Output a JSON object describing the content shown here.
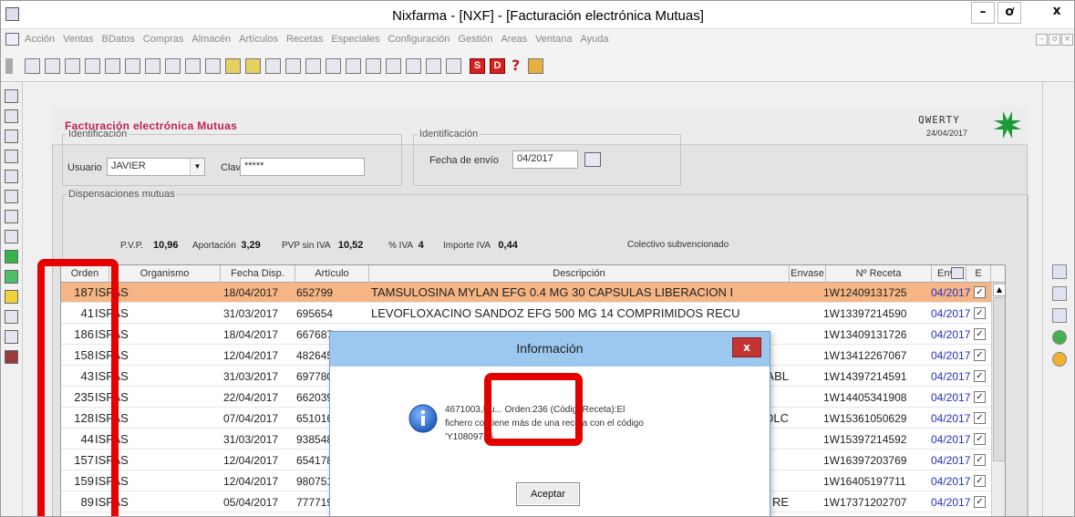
{
  "window": {
    "title": "Nixfarma - [NXF] - [Facturación electrónica Mutuas]",
    "controls": {
      "minimize": "–",
      "maximize": "ơ",
      "close": "x"
    },
    "mdi_controls": [
      "–",
      "ơ",
      "×"
    ]
  },
  "menu": [
    "Acción",
    "Ventas",
    "BDatos",
    "Compras",
    "Almacén",
    "Artículos",
    "Recetas",
    "Especiales",
    "Configuración",
    "Gestión",
    "Areas",
    "Ventana",
    "Ayuda"
  ],
  "toolbar": {
    "red_buttons": [
      "S",
      "D"
    ],
    "help_glyph": "?"
  },
  "header": {
    "title": "Facturación electrónica Mutuas",
    "user": "QWERTY",
    "date": "24/04/2017"
  },
  "identification_left": {
    "legend": "Identificación",
    "user_label": "Usuario",
    "user_value": "JAVIER",
    "password_label": "Clave",
    "password_value": "*****"
  },
  "identification_right": {
    "legend": "Identificación",
    "send_date_label": "Fecha de envío",
    "send_date_value": "04/2017"
  },
  "dispensations": {
    "legend": "Dispensaciones mutuas",
    "summary": {
      "pvp_label": "P.V.P.",
      "pvp_value": "10,96",
      "aportacion_label": "Aportación",
      "aportacion_value": "3,29",
      "pvp_sin_iva_label": "PVP sin IVA",
      "pvp_sin_iva_value": "10,52",
      "iva_label": "% IVA",
      "iva_value": "4",
      "importe_iva_label": "Importe IVA",
      "importe_iva_value": "0,44",
      "colectivo": "Colectivo subvencionado"
    }
  },
  "grid": {
    "columns": [
      "Orden",
      "Organismo",
      "Fecha Disp.",
      "Artículo",
      "Descripción",
      "Envase",
      "Nº Receta",
      "Env.",
      "E"
    ],
    "rows": [
      {
        "orden": "187",
        "organismo": "ISFAS",
        "fecha": "18/04/2017",
        "articulo": "652799",
        "descripcion": "TAMSULOSINA MYLAN EFG 0.4 MG 30 CAPSULAS LIBERACION I",
        "receta": "1W12409131725",
        "env": "04/2017",
        "selected": true
      },
      {
        "orden": "41",
        "organismo": "ISFAS",
        "fecha": "31/03/2017",
        "articulo": "695654",
        "descripcion": "LEVOFLOXACINO SANDOZ EFG 500 MG 14 COMPRIMIDOS RECU",
        "receta": "1W13397214590",
        "env": "04/2017"
      },
      {
        "orden": "186",
        "organismo": "ISFAS",
        "fecha": "18/04/2017",
        "articulo": "667687",
        "descripcion": "",
        "receta": "1W13409131726",
        "env": "04/2017"
      },
      {
        "orden": "158",
        "organismo": "ISFAS",
        "fecha": "12/04/2017",
        "articulo": "482645",
        "descripcion": "",
        "receta": "1W13412267067",
        "env": "04/2017"
      },
      {
        "orden": "43",
        "organismo": "ISFAS",
        "fecha": "31/03/2017",
        "articulo": "697780",
        "descripcion": "ABL",
        "receta": "1W14397214591",
        "env": "04/2017"
      },
      {
        "orden": "235",
        "organismo": "ISFAS",
        "fecha": "22/04/2017",
        "articulo": "662039",
        "descripcion": "",
        "receta": "1W14405341908",
        "env": "04/2017"
      },
      {
        "orden": "128",
        "organismo": "ISFAS",
        "fecha": "07/04/2017",
        "articulo": "651016",
        "descripcion": "OLC",
        "receta": "1W15361050629",
        "env": "04/2017"
      },
      {
        "orden": "44",
        "organismo": "ISFAS",
        "fecha": "31/03/2017",
        "articulo": "938548",
        "descripcion": "",
        "receta": "1W15397214592",
        "env": "04/2017"
      },
      {
        "orden": "157",
        "organismo": "ISFAS",
        "fecha": "12/04/2017",
        "articulo": "654178",
        "descripcion": "",
        "receta": "1W16397203769",
        "env": "04/2017"
      },
      {
        "orden": "159",
        "organismo": "ISFAS",
        "fecha": "12/04/2017",
        "articulo": "980751",
        "descripcion": "",
        "receta": "1W16405197711",
        "env": "04/2017"
      },
      {
        "orden": "89",
        "organismo": "ISFAS",
        "fecha": "05/04/2017",
        "articulo": "777719",
        "descripcion": "RE",
        "receta": "1W17371202707",
        "env": "04/2017"
      }
    ]
  },
  "dialog": {
    "title": "Información",
    "close": "x",
    "message": "4671003,Nu... Orden:236 (CódigoReceta):El fichero contiene más de una receta con el código 'Y10809776...",
    "ok_button": "Aceptar"
  },
  "colors": {
    "header_title": "#c0205a",
    "selected_row": "#f6b585",
    "dialog_title_bg": "#9cc7ef",
    "dialog_close_bg": "#c43434",
    "annotation": "#e50000",
    "env_blue": "#2030c0"
  }
}
